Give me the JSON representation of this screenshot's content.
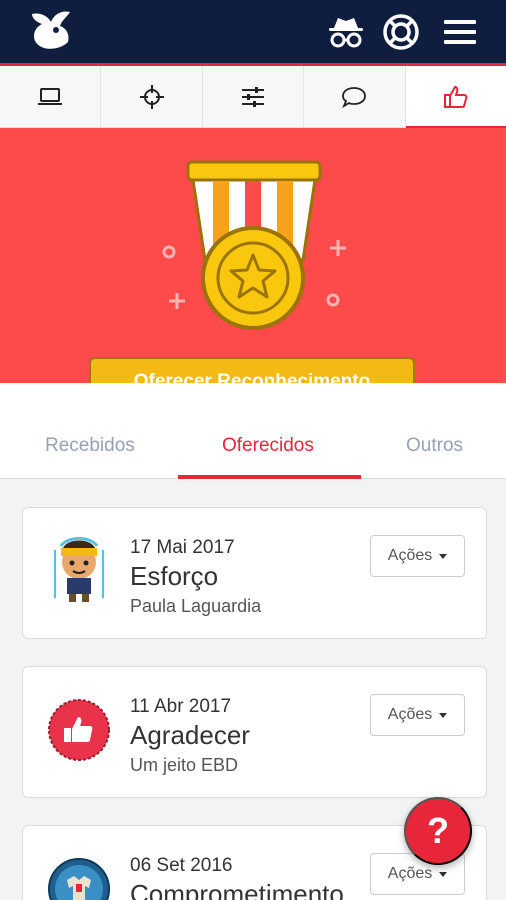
{
  "topbar": {
    "icons": [
      "logo-icon",
      "spy-icon",
      "lifebuoy-icon",
      "hamburger-menu-icon"
    ]
  },
  "tabs": [
    {
      "icon": "laptop-icon",
      "active": false
    },
    {
      "icon": "crosshair-icon",
      "active": false
    },
    {
      "icon": "sliders-icon",
      "active": false
    },
    {
      "icon": "chat-bubble-icon",
      "active": false
    },
    {
      "icon": "thumbs-up-icon",
      "active": true
    }
  ],
  "hero": {
    "cta_label": "Oferecer Reconhecimento"
  },
  "subtabs": {
    "received": "Recebidos",
    "offered": "Oferecidos",
    "others": "Outros",
    "active": "offered"
  },
  "cards": [
    {
      "date": "17 Mai 2017",
      "title": "Esforço",
      "sub": "Paula Laguardia",
      "actions": "Ações",
      "avatar": "runner-avatar-icon"
    },
    {
      "date": "11 Abr 2017",
      "title": "Agradecer",
      "sub": "Um jeito EBD",
      "actions": "Ações",
      "avatar": "thumbs-up-badge-icon"
    },
    {
      "date": "06 Set 2016",
      "title": "Comprometimento",
      "sub": "",
      "actions": "Ações",
      "avatar": "shirt-badge-icon"
    }
  ],
  "fab": {
    "label": "?"
  },
  "colors": {
    "topbar": "#0f1d3f",
    "accent": "#e8263a",
    "hero": "#fd4a4a",
    "cta": "#f3b914"
  }
}
